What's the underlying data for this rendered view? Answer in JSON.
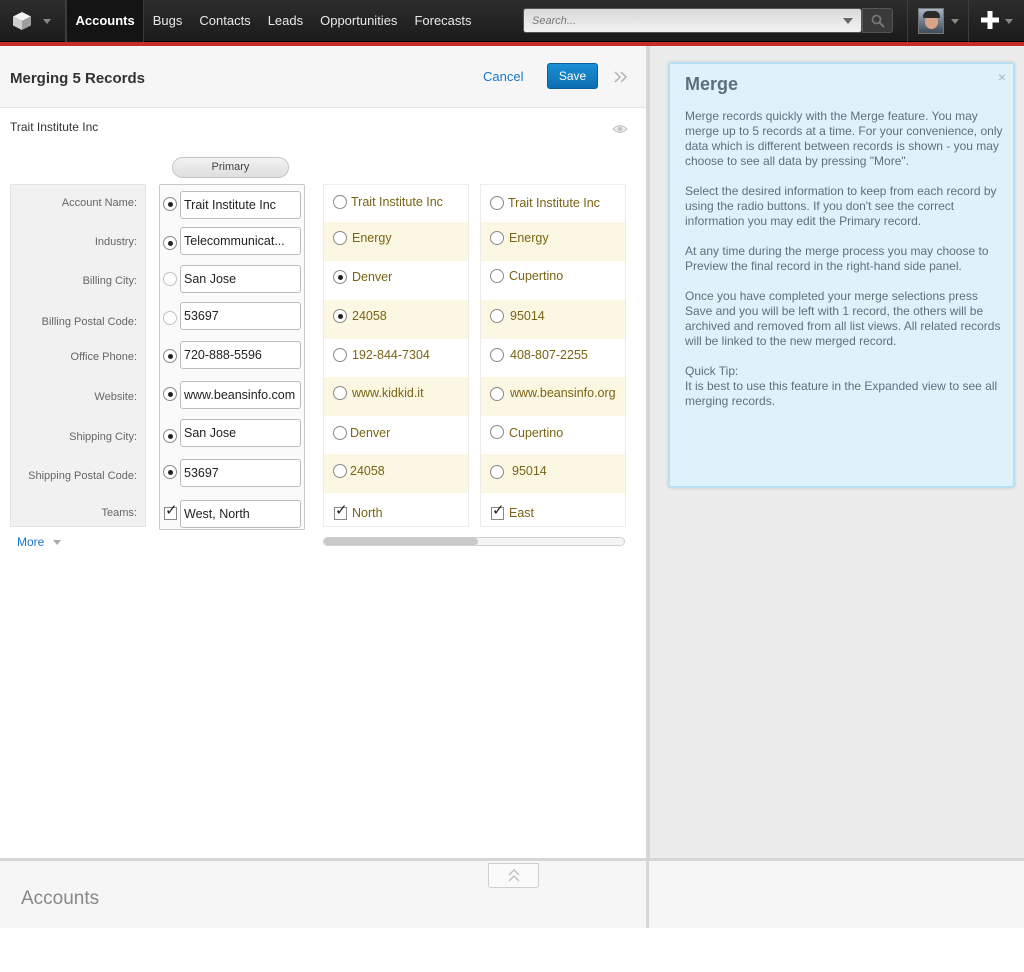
{
  "nav": {
    "tabs": [
      "Accounts",
      "Bugs",
      "Contacts",
      "Leads",
      "Opportunities",
      "Forecasts"
    ],
    "search_placeholder": "Search..."
  },
  "header": {
    "title": "Merging 5 Records",
    "cancel_label": "Cancel",
    "save_label": "Save"
  },
  "record_name": "Trait Institute Inc",
  "primary_label": "Primary",
  "fields": [
    "Account Name:",
    "Industry:",
    "Billing City:",
    "Billing Postal Code:",
    "Office Phone:",
    "Website:",
    "Shipping City:",
    "Shipping Postal Code:",
    "Teams:"
  ],
  "primary_values": [
    "Trait Institute Inc",
    "Telecommunicat...",
    "San Jose",
    "53697",
    "720-888-5596",
    "www.beansinfo.com",
    "San Jose",
    "53697",
    "West, North"
  ],
  "records": [
    {
      "values": [
        "Trait Institute Inc",
        "Energy",
        "Denver",
        "24058",
        "192-844-7304",
        "www.kidkid.it",
        "Denver",
        "24058",
        "North"
      ]
    },
    {
      "values": [
        "Trait Institute Inc",
        "Energy",
        "Cupertino",
        "95014",
        "408-807-2255",
        "www.beansinfo.org",
        "Cupertino",
        "95014",
        "East"
      ]
    }
  ],
  "more_label": "More",
  "help": {
    "title": "Merge",
    "close": "×",
    "paragraphs": [
      "Merge records quickly with the Merge feature. You may merge up to 5 records at a time. For your convenience, only data which is different between records is shown - you may choose to see all data by pressing \"More\".",
      "Select the desired information to keep from each record by using the radio buttons. If you don't see the correct information you may edit the Primary record.",
      "At any time during the merge process you may choose to Preview the final record in the right-hand side panel.",
      "Once  you have completed your merge selections press Save and you will be left with 1 record, the others will be archived and removed from all list views. All related records will be linked to the new merged record."
    ],
    "tip_title": "Quick Tip:",
    "tip_body": "It is best to use this feature in the Expanded view to see all merging records."
  },
  "bottom_title": "Accounts",
  "colors": {
    "accent": "#1a77c9",
    "save": "#1683c9",
    "nav_red": "#c72b2b",
    "highlight": "#fcf7e3",
    "help_bg": "#dff2fc"
  },
  "icons": [
    "cube-logo-icon",
    "search-icon",
    "avatar",
    "plus-icon",
    "eye-icon",
    "chevrons-right-icon",
    "close-icon",
    "chevrons-up-icon"
  ]
}
